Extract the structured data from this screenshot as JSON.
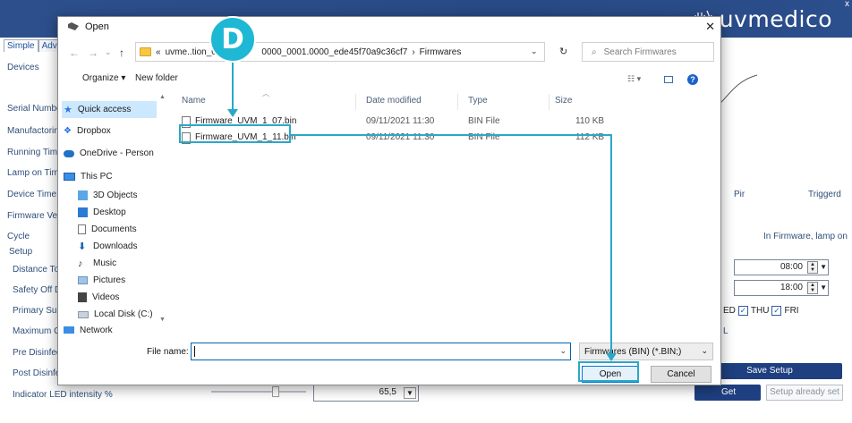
{
  "app": {
    "brand": "uvmedico",
    "close_glyph": "x",
    "tabs": [
      "Simple",
      "Adva"
    ],
    "left_labels": [
      {
        "key": "devices",
        "text": "Devices"
      },
      {
        "key": "serial",
        "text": "Serial Numbe"
      },
      {
        "key": "manufacturing",
        "text": "Manufactorin"
      },
      {
        "key": "running",
        "text": "Running Time"
      },
      {
        "key": "lamp",
        "text": "Lamp on Tim"
      },
      {
        "key": "device-time",
        "text": "Device Time"
      },
      {
        "key": "firmware",
        "text": "Firmware Ver"
      },
      {
        "key": "cycle",
        "text": "Cycle"
      },
      {
        "key": "setup",
        "text": "Setup"
      },
      {
        "key": "distance",
        "text": "Distance To"
      },
      {
        "key": "safety",
        "text": "Safety Off D"
      },
      {
        "key": "primary",
        "text": "Primary Surf"
      },
      {
        "key": "maximum",
        "text": "Maximum O"
      },
      {
        "key": "pre",
        "text": "Pre Disinfect"
      },
      {
        "key": "post",
        "text": "Post Disinfec"
      },
      {
        "key": "indicator",
        "text": "Indicator LED intensity %"
      }
    ],
    "pir": "Pir",
    "triggerd": "Triggerd",
    "firmware_status": "In Firmware, lamp on",
    "time1": "08:00",
    "time2": "18:00",
    "days": {
      "wed": "ED",
      "thu": "THU",
      "fri": "FRI"
    },
    "partial_l": "L",
    "save_setup": "Save Setup",
    "get": "Get",
    "setup_set": "Setup already set",
    "led_value": "65,5"
  },
  "dialog": {
    "title": "Open",
    "close_glyph": "✕",
    "nav": {
      "back": "←",
      "forward": "→",
      "recent": "⌄",
      "up": "↑"
    },
    "address_prefix": "«",
    "address_seg1": "uvme..tion_00",
    "address_seg2": "0000_0001.0000_ede45f70a9c36cf7",
    "address_sep": "›",
    "address_seg3": "Firmwares",
    "search_placeholder": "Search Firmwares",
    "organize": "Organize ▾",
    "new_folder": "New folder",
    "nav_items": [
      {
        "label": "Quick access",
        "icon": "star-icon"
      },
      {
        "label": "Dropbox",
        "icon": "dropbox-icon"
      },
      {
        "label": "OneDrive - Person",
        "icon": "cloud-icon"
      },
      {
        "label": "This PC",
        "icon": "pc-icon"
      },
      {
        "label": "3D Objects",
        "icon": "cube-icon"
      },
      {
        "label": "Desktop",
        "icon": "desktop-icon"
      },
      {
        "label": "Documents",
        "icon": "document-icon"
      },
      {
        "label": "Downloads",
        "icon": "download-icon"
      },
      {
        "label": "Music",
        "icon": "music-icon"
      },
      {
        "label": "Pictures",
        "icon": "pictures-icon"
      },
      {
        "label": "Videos",
        "icon": "video-icon"
      },
      {
        "label": "Local Disk (C:)",
        "icon": "disk-icon"
      },
      {
        "label": "Network",
        "icon": "network-icon"
      }
    ],
    "columns": {
      "name": "Name",
      "date": "Date modified",
      "type": "Type",
      "size": "Size"
    },
    "files": [
      {
        "name": "Firmware_UVM_1_07.bin",
        "date": "09/11/2021 11:30",
        "type": "BIN File",
        "size": "110 KB"
      },
      {
        "name": "Firmware_UVM_1_11.bin",
        "date": "09/11/2021 11:30",
        "type": "BIN File",
        "size": "112 KB"
      }
    ],
    "filename_label": "File name:",
    "filename_value": "",
    "filetype": "Firmwares (BIN) (*.BIN;)",
    "open": "Open",
    "cancel": "Cancel"
  },
  "annotation": {
    "badge": "D",
    "accent": "#2aa8c8"
  },
  "colors": {
    "header": "#2d4f8c",
    "accent_button": "#1e3f80",
    "selection": "#cce8ff"
  }
}
